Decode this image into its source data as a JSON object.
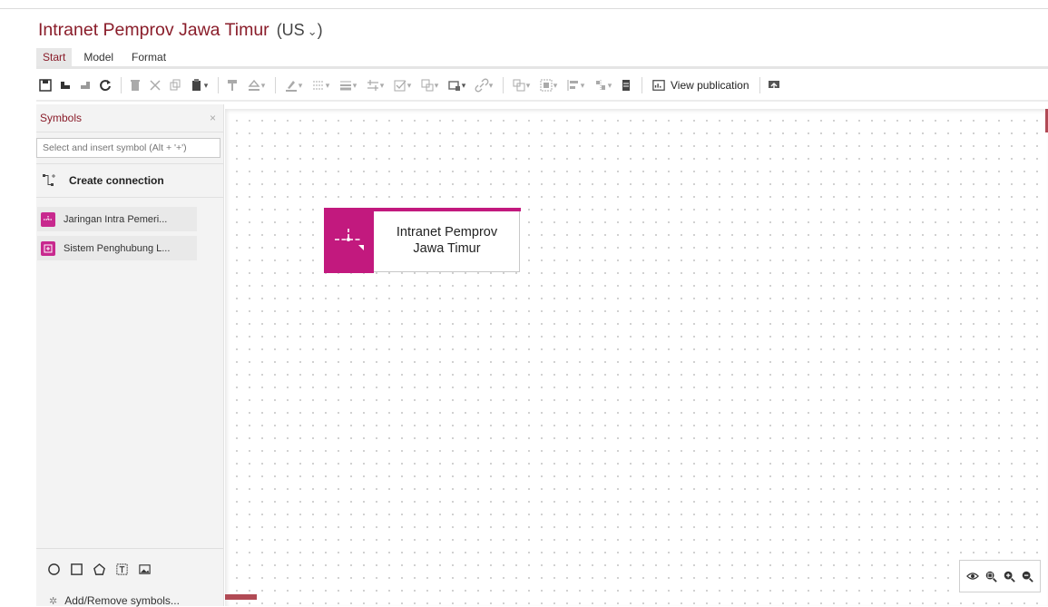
{
  "header": {
    "title": "Intranet Pemprov Jawa Timur",
    "language": "(US",
    "language_suffix": ")"
  },
  "tabs": [
    {
      "label": "Start",
      "active": true
    },
    {
      "label": "Model",
      "active": false
    },
    {
      "label": "Format",
      "active": false
    }
  ],
  "toolbar": {
    "view_publication": "View publication",
    "icons": [
      "save-icon",
      "undo-icon",
      "redo-icon",
      "refresh-icon",
      "delete-icon",
      "cut-icon",
      "copy-icon",
      "paste-icon",
      "format-painter-icon",
      "fill-icon",
      "line-color-icon",
      "line-style-icon",
      "line-weight-icon",
      "arrange-icon",
      "checkbox-icon",
      "attribute-icon",
      "shape-icon",
      "link-icon",
      "group-icon",
      "align-icon",
      "distribute-icon",
      "size-icon",
      "bookmark-icon",
      "view-publication-icon",
      "upload-icon"
    ]
  },
  "sidebar": {
    "title": "Symbols",
    "close": "×",
    "search_placeholder": "Select and insert symbol (Alt + '+')",
    "create_connection": "Create connection",
    "symbols": [
      {
        "label": "Jaringan Intra Pemeri..."
      },
      {
        "label": "Sistem Penghubung L..."
      }
    ],
    "shapes": [
      "circle-icon",
      "square-icon",
      "pentagon-icon",
      "text-box-icon",
      "image-icon"
    ],
    "add_remove": "Add/Remove symbols..."
  },
  "canvas": {
    "node_label_line1": "Intranet Pemprov",
    "node_label_line2": "Jawa Timur"
  },
  "zoom_controls": [
    "eye-icon",
    "zoom-fit-icon",
    "zoom-in-icon",
    "zoom-out-icon"
  ],
  "colors": {
    "accent": "#8a1d2a",
    "symbol_magenta": "#c2197e"
  }
}
